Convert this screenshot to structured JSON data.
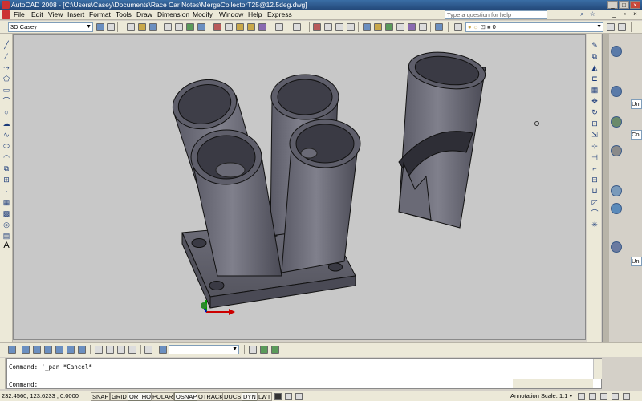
{
  "window": {
    "title": "AutoCAD 2008 - [C:\\Users\\Casey\\Documents\\Race Car Notes\\MergeCollectorT25@12.5deg.dwg]",
    "min_label": "_",
    "max_label": "□",
    "close_label": "×"
  },
  "menu": {
    "items": [
      "File",
      "Edit",
      "View",
      "Insert",
      "Format",
      "Tools",
      "Draw",
      "Dimension",
      "Modify",
      "Window",
      "Help",
      "Express"
    ],
    "help_placeholder": "Type a question for help",
    "doc_min_label": "_",
    "doc_restore_label": "▫",
    "doc_close_label": "×"
  },
  "toolbar": {
    "workspace_value": "3D Casey",
    "layer_value": "0"
  },
  "left_tools": {
    "text_tool_label": "A"
  },
  "dashboard": {
    "field1": "Un",
    "field2": "Co",
    "field3": "Un"
  },
  "command": {
    "history": "Command: '_pan *Cancel*",
    "prompt": "Command:"
  },
  "status": {
    "coords": "232.4560, 123.6233 , 0.0000",
    "toggles": [
      {
        "label": "SNAP",
        "on": false
      },
      {
        "label": "GRID",
        "on": false
      },
      {
        "label": "ORTHO",
        "on": true
      },
      {
        "label": "POLAR",
        "on": false
      },
      {
        "label": "OSNAP",
        "on": true
      },
      {
        "label": "OTRACK",
        "on": false
      },
      {
        "label": "DUCS",
        "on": false
      },
      {
        "label": "DYN",
        "on": true
      },
      {
        "label": "LWT",
        "on": false
      }
    ],
    "annotation_scale_label": "Annotation Scale:",
    "annotation_scale_value": "1:1 ▾"
  }
}
